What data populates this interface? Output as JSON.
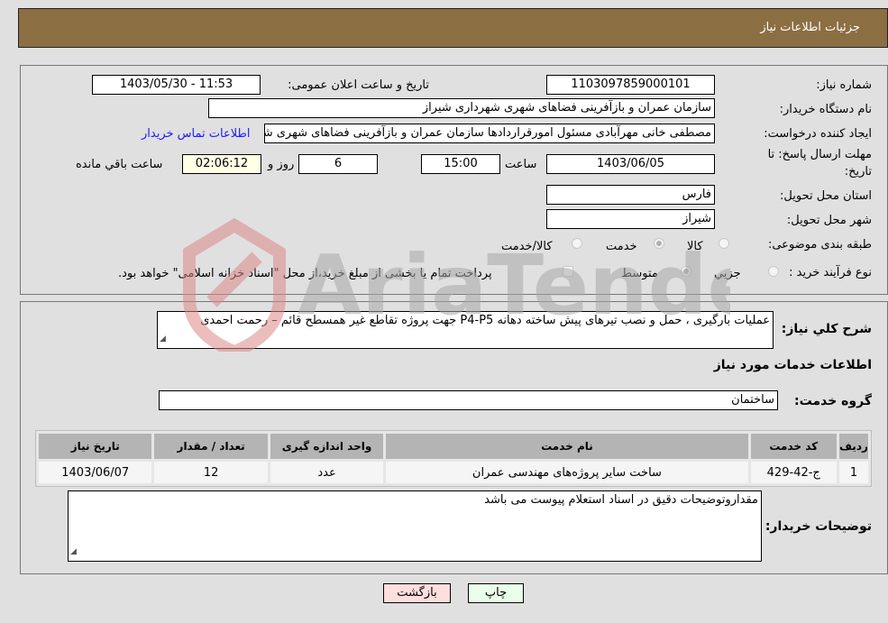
{
  "header": {
    "title": "جزئیات اطلاعات نیاز"
  },
  "form": {
    "need_number": {
      "label": "شماره نیاز:",
      "value": "1103097859000101"
    },
    "announce_datetime": {
      "label": "تاریخ و ساعت اعلان عمومی:",
      "value": "1403/05/30 - 11:53"
    },
    "buyer_org": {
      "label": "نام دستگاه خریدار:",
      "value": "سازمان عمران و بازآفرینی فضاهای شهری شهرداری شیراز"
    },
    "requester": {
      "label": "ایجاد کننده درخواست:",
      "value": "مصطفی خانی مهرآبادی مسئول امورقراردادها سازمان عمران و بازآفرینی فضاهای شهری شهرداری شیراز"
    },
    "contact_link": "اطلاعات تماس خریدار",
    "deadline": {
      "label_line1": "مهلت ارسال پاسخ: تا",
      "label_line2": "تاریخ:",
      "date": "1403/06/05",
      "time_label": "ساعت",
      "time": "15:00",
      "days": "6",
      "days_label": "روز و",
      "remaining": "02:06:12",
      "remaining_label": "ساعت باقي مانده"
    },
    "province": {
      "label": "استان محل تحویل:",
      "value": "فارس"
    },
    "city": {
      "label": "شهر محل تحویل:",
      "value": "شیراز"
    },
    "category": {
      "label": "طبقه بندی موضوعی:",
      "options": [
        "کالا",
        "خدمت",
        "کالا/خدمت"
      ],
      "selected": "خدمت"
    },
    "purchase_type": {
      "label": "نوع فرآیند خرید :",
      "options": [
        "جزيي",
        "متوسط"
      ],
      "selected": "متوسط",
      "treasury_note": "پرداخت تمام یا بخشی از مبلغ خرید،از محل \"اسناد خزانه اسلامی\" خواهد بود.",
      "treasury_checked": false
    }
  },
  "description": {
    "label": "شرح كلي نياز:",
    "value": "عملیات بارگیری ، حمل و نصب تیرهای پیش ساخته دهانه P4-P5  جهت پروژه تقاطع غیر همسطح قائم – رحمت احمدی"
  },
  "services": {
    "section_title": "اطلاعات خدمات مورد نياز",
    "group_label": "گروه خدمت:",
    "group_value": "ساختمان",
    "table": {
      "headers": [
        "ردیف",
        "کد خدمت",
        "نام خدمت",
        "واحد اندازه گیری",
        "تعداد / مقدار",
        "تاریخ نیاز"
      ],
      "rows": [
        [
          "1",
          "ج-42-429",
          "ساخت سایر پروژه‌های مهندسی عمران",
          "عدد",
          "12",
          "1403/06/07"
        ]
      ]
    }
  },
  "buyer_notes": {
    "label": "توضیحات خریدار:",
    "value": "مقداروتوضیحات دقیق در اسناد استعلام پیوست می باشد"
  },
  "buttons": {
    "print": "چاپ",
    "back": "بازگشت"
  },
  "watermark": "AriaTender.neT"
}
